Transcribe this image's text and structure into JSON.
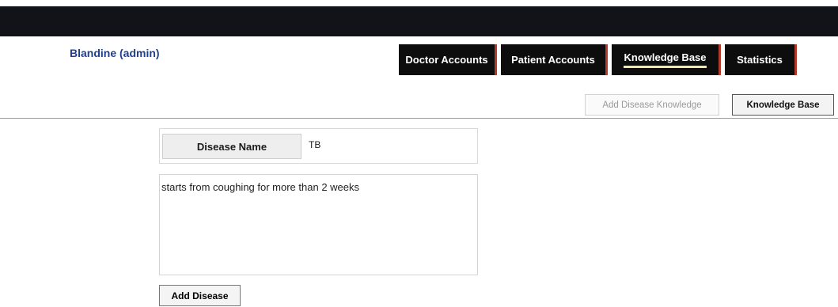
{
  "user": {
    "name": "Blandine (admin)"
  },
  "nav": [
    {
      "label": "Doctor Accounts"
    },
    {
      "label": "Patient Accounts"
    },
    {
      "label": "Knowledge Base",
      "active": true
    },
    {
      "label": "Statistics"
    }
  ],
  "subnav": {
    "add_disease_knowledge": "Add Disease Knowledge",
    "knowledge_base": "Knowledge Base"
  },
  "form": {
    "disease_name_label": "Disease Name",
    "disease_name_value": "TB",
    "description": "starts from coughing for more than 2 weeks",
    "submit_label": "Add Disease"
  },
  "colors": {
    "topbar": "#111318",
    "nav_bg": "#0d0d0d",
    "nav_accent": "#b23a2a",
    "active_underline": "#f2e7a8",
    "user_text": "#1f3f8f"
  }
}
